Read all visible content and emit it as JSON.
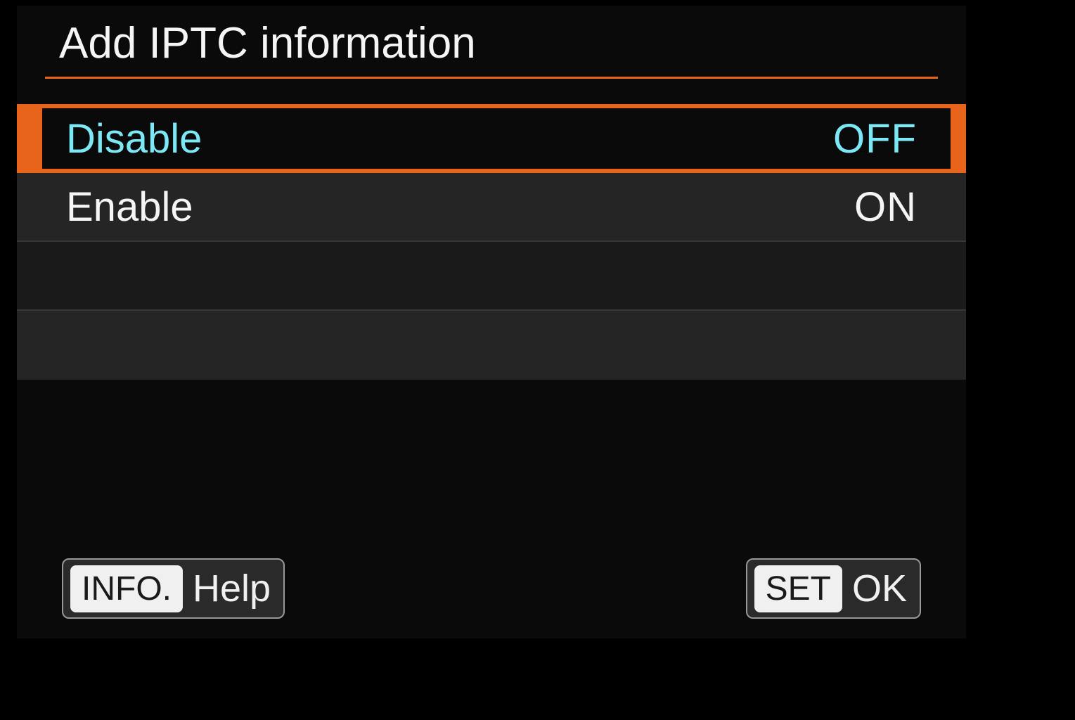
{
  "header": {
    "title": "Add IPTC information"
  },
  "options": {
    "items": [
      {
        "label": "Disable",
        "value": "OFF",
        "selected": true
      },
      {
        "label": "Enable",
        "value": "ON",
        "selected": false
      }
    ]
  },
  "footer": {
    "left": {
      "button": "INFO.",
      "label": "Help"
    },
    "right": {
      "button": "SET",
      "label": "OK"
    }
  }
}
